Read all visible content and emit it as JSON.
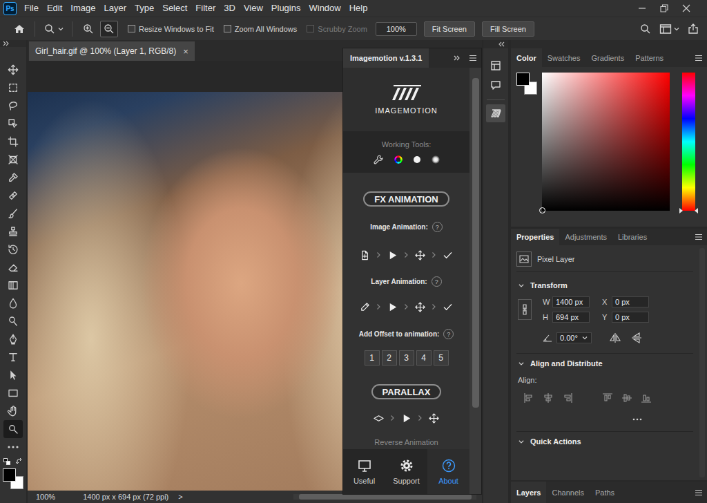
{
  "app": {
    "logo": "Ps"
  },
  "menu": [
    "File",
    "Edit",
    "Image",
    "Layer",
    "Type",
    "Select",
    "Filter",
    "3D",
    "View",
    "Plugins",
    "Window",
    "Help"
  ],
  "options_bar": {
    "zoom_modes": [
      {
        "selected": false
      },
      {
        "selected": true
      }
    ],
    "checkboxes": [
      {
        "label": "Resize Windows to Fit",
        "checked": false,
        "disabled": false
      },
      {
        "label": "Zoom All Windows",
        "checked": false,
        "disabled": false
      },
      {
        "label": "Scrubby Zoom",
        "checked": false,
        "disabled": true
      }
    ],
    "zoom_field": "100%",
    "buttons": [
      "Fit Screen",
      "Fill Screen"
    ]
  },
  "tools": [
    {
      "selected": false
    },
    {
      "selected": false
    },
    {
      "selected": false
    },
    {
      "selected": false
    },
    {
      "selected": false
    },
    {
      "selected": false
    },
    {
      "selected": false
    },
    {
      "selected": false
    },
    {
      "selected": false
    },
    {
      "selected": false
    },
    {
      "selected": false
    },
    {
      "selected": false
    },
    {
      "selected": false
    },
    {
      "selected": false
    },
    {
      "selected": false
    },
    {
      "selected": false
    },
    {
      "selected": false
    },
    {
      "selected": false
    },
    {
      "selected": false
    },
    {
      "selected": false
    },
    {
      "selected": true
    }
  ],
  "document": {
    "tab": {
      "title": "Girl_hair.gif @ 100% (Layer 1, RGB/8)",
      "close": "×",
      "selected": true
    },
    "status": {
      "zoom": "100%",
      "info": "1400 px x 694 px (72 ppi)",
      "arrow": ">"
    }
  },
  "imagemotion": {
    "title": "Imagemotion v.1.3.1",
    "logo_text": "IMAGEMOTION",
    "working_tools_label": "Working Tools:",
    "fx_button": "FX ANIMATION",
    "animations": [
      {
        "label": "Image Animation:",
        "help": "?"
      },
      {
        "label": "Layer Animation:",
        "help": "?"
      }
    ],
    "offset": {
      "label": "Add Offset to animation:",
      "help": "?",
      "buttons": [
        "1",
        "2",
        "3",
        "4",
        "5"
      ]
    },
    "parallax_button": "PARALLAX",
    "reverse": "Reverse Animation",
    "footer_tabs": [
      {
        "label": "Useful",
        "selected": false
      },
      {
        "label": "Support",
        "selected": false
      },
      {
        "label": "About",
        "selected": true
      }
    ]
  },
  "dock": [
    {
      "selected": false
    },
    {
      "selected": false
    },
    {
      "selected": true
    }
  ],
  "color_panel": {
    "tabs": [
      {
        "label": "Color",
        "selected": true
      },
      {
        "label": "Swatches",
        "selected": false
      },
      {
        "label": "Gradients",
        "selected": false
      },
      {
        "label": "Patterns",
        "selected": false
      }
    ]
  },
  "properties": {
    "tabs": [
      {
        "label": "Properties",
        "selected": true
      },
      {
        "label": "Adjustments",
        "selected": false
      },
      {
        "label": "Libraries",
        "selected": false
      }
    ],
    "layer_kind": "Pixel Layer",
    "transform": {
      "title": "Transform",
      "expanded": true,
      "fields": [
        {
          "label": "W",
          "value": "1400 px"
        },
        {
          "label": "H",
          "value": "694 px"
        },
        {
          "label": "X",
          "value": "0 px"
        },
        {
          "label": "Y",
          "value": "0 px"
        }
      ],
      "angle": "0.00°"
    },
    "align": {
      "title": "Align and Distribute",
      "expanded": true,
      "label": "Align:"
    },
    "quick_actions": {
      "title": "Quick Actions",
      "expanded": true
    }
  },
  "layers_panel": {
    "tabs": [
      {
        "label": "Layers",
        "selected": true
      },
      {
        "label": "Channels",
        "selected": false
      },
      {
        "label": "Paths",
        "selected": false
      }
    ]
  }
}
